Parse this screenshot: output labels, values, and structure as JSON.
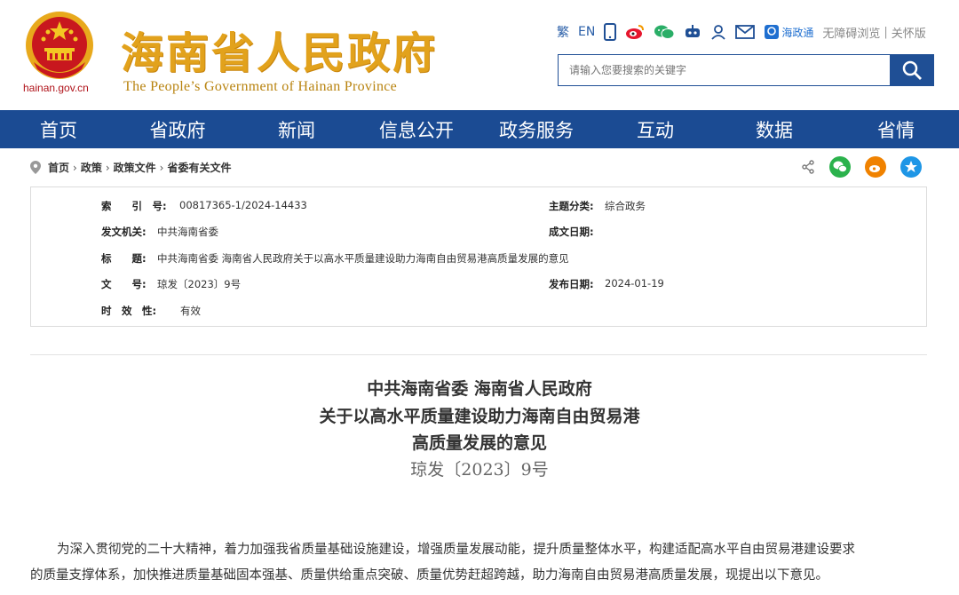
{
  "header": {
    "title": "海南省人民政府",
    "subtitle": "The People’s Government  of Hainan Province",
    "domain": "hainan.gov.cn"
  },
  "topbar": {
    "traditional": "繁",
    "english": "EN",
    "app_label": "海政通",
    "accessibility": "无障碍浏览",
    "separator": "|",
    "elder_mode": "关怀版"
  },
  "search": {
    "placeholder": "请输入您要搜索的关键字"
  },
  "nav": {
    "items": [
      {
        "label": "首页"
      },
      {
        "label": "省政府"
      },
      {
        "label": "新闻"
      },
      {
        "label": "信息公开"
      },
      {
        "label": "政务服务"
      },
      {
        "label": "互动"
      },
      {
        "label": "数据"
      },
      {
        "label": "省情"
      }
    ]
  },
  "breadcrumb": {
    "items": [
      "首页",
      "政策",
      "政策文件",
      "省委有关文件"
    ],
    "arrow": "›"
  },
  "meta": {
    "index_label": "索　　引　号:",
    "index_value": "00817365-1/2024-14433",
    "topic_label": "主题分类:",
    "topic_value": "综合政务",
    "issuer_label": "发文机关:",
    "issuer_value": "中共海南省委",
    "date_written_label": "成文日期:",
    "date_written_value": "",
    "title_label": "标　　题:",
    "title_value": "中共海南省委 海南省人民政府关于以高水平质量建设助力海南自由贸易港高质量发展的意见",
    "docno_label": "文　　号:",
    "docno_value": "琼发〔2023〕9号",
    "publish_label": "发布日期:",
    "publish_value": "2024-01-19",
    "validity_label": "时　效　性:",
    "validity_value": "有效"
  },
  "document": {
    "title_line1": "中共海南省委  海南省人民政府",
    "title_line2": "关于以高水平质量建设助力海南自由贸易港",
    "title_line3": "高质量发展的意见",
    "doc_number": "琼发〔2023〕9号",
    "para1_line1": "为深入贯彻党的二十大精神，着力加强我省质量基础设施建设，增强质量发展动能，提升质量整体水平，构建适配高水平自由贸易港建设要求",
    "para1_line2": "的质量支撑体系，加快推进质量基础固本强基、质量供给重点突破、质量优势赶超跨越，助力海南自由贸易港高质量发展，现提出以下意见。"
  },
  "colors": {
    "nav_bg": "#1b4b93",
    "title_gold": "#e2a21c",
    "emblem_red": "#c8171e"
  }
}
